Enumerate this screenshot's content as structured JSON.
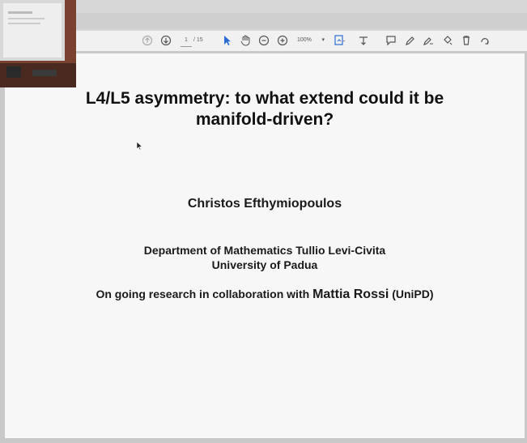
{
  "toolbar": {
    "page_current": "1",
    "page_total": "/ 15",
    "zoom_value": "100%",
    "icons": [
      "page-up-icon",
      "page-down-icon",
      "select-cursor-icon",
      "hand-icon",
      "zoom-out-icon",
      "zoom-in-icon",
      "fit-page-icon",
      "print-icon",
      "comment-icon",
      "pen-icon",
      "draw-icon",
      "stamp-icon",
      "delete-icon",
      "rotate-icon"
    ]
  },
  "slide": {
    "title_line1": "L4/L5 asymmetry: to what extend could it be",
    "title_line2": "manifold-driven?",
    "author": "Christos Efthymiopoulos",
    "affiliation_line1": "Department of Mathematics Tullio Levi-Civita",
    "affiliation_line2": "University of Padua",
    "collab_prefix": "On going research in collaboration with ",
    "collab_name": "Mattia Rossi",
    "collab_suffix": " (UniPD)"
  },
  "colors": {
    "toolbar_bg": "#f1f1f1",
    "accent": "#2b6cd4",
    "slide_bg": "#f7f7f7"
  }
}
